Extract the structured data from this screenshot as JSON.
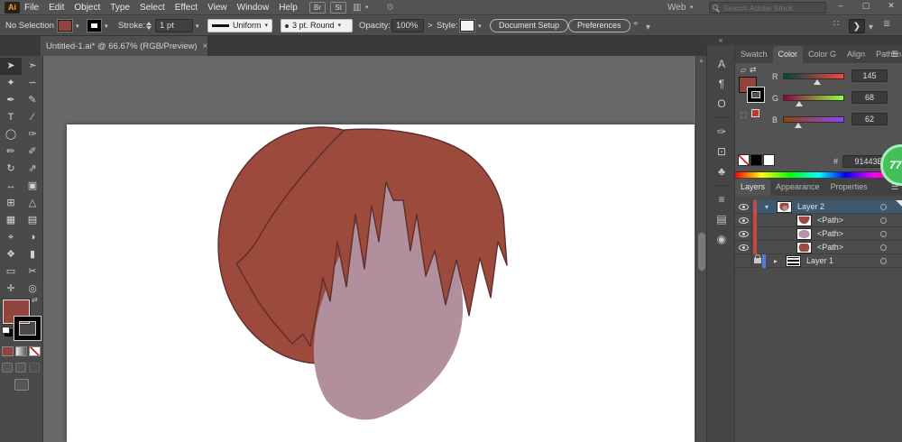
{
  "titlebar": {
    "logo": "Ai",
    "menus": [
      "File",
      "Edit",
      "Object",
      "Type",
      "Select",
      "Effect",
      "View",
      "Window",
      "Help"
    ],
    "bridge_button": "Br",
    "stock_button": "St",
    "workspace_label": "Web",
    "search_placeholder": "Search Adobe Stock",
    "minimize": "–",
    "maximize": "▢",
    "close": "✕"
  },
  "control_bar": {
    "selection_status": "No Selection",
    "stroke_label": "Stroke:",
    "stroke_width": "1 pt",
    "variable_width_profile": "Uniform",
    "brush_definition": "3 pt. Round",
    "opacity_label": "Opacity:",
    "opacity_value": "100%",
    "more_glyph": ">",
    "style_label": "Style:",
    "document_setup_label": "Document Setup",
    "preferences_label": "Preferences"
  },
  "document_tab": {
    "title": "Untitled-1.ai* @ 66.67% (RGB/Preview)",
    "close_glyph": "×"
  },
  "toolbar": {
    "tools": [
      {
        "name": "selection-tool",
        "glyph": "➤",
        "selected": true
      },
      {
        "name": "direct-selection-tool",
        "glyph": "➣"
      },
      {
        "name": "magic-wand-tool",
        "glyph": "✦"
      },
      {
        "name": "lasso-tool",
        "glyph": "∽"
      },
      {
        "name": "pen-tool",
        "glyph": "✒"
      },
      {
        "name": "curvature-tool",
        "glyph": "✎"
      },
      {
        "name": "type-tool",
        "glyph": "T"
      },
      {
        "name": "line-segment-tool",
        "glyph": "∕"
      },
      {
        "name": "ellipse-tool",
        "glyph": "◯"
      },
      {
        "name": "paintbrush-tool",
        "glyph": "✑"
      },
      {
        "name": "pencil-tool",
        "glyph": "✏"
      },
      {
        "name": "shaper-tool",
        "glyph": "✐"
      },
      {
        "name": "rotate-tool",
        "glyph": "↻"
      },
      {
        "name": "scale-tool",
        "glyph": "⇗"
      },
      {
        "name": "width-tool",
        "glyph": "↔"
      },
      {
        "name": "free-transform-tool",
        "glyph": "▣"
      },
      {
        "name": "shape-builder-tool",
        "glyph": "⊞"
      },
      {
        "name": "perspective-grid-tool",
        "glyph": "△"
      },
      {
        "name": "mesh-tool",
        "glyph": "▦"
      },
      {
        "name": "gradient-tool",
        "glyph": "▤"
      },
      {
        "name": "eyedropper-tool",
        "glyph": "⌖"
      },
      {
        "name": "blend-tool",
        "glyph": "◑"
      },
      {
        "name": "symbol-sprayer-tool",
        "glyph": "❖"
      },
      {
        "name": "column-graph-tool",
        "glyph": "▮"
      },
      {
        "name": "artboard-tool",
        "glyph": "▭"
      },
      {
        "name": "slice-tool",
        "glyph": "✂"
      },
      {
        "name": "hand-tool",
        "glyph": "✛"
      },
      {
        "name": "zoom-tool",
        "glyph": "◎"
      }
    ]
  },
  "dock": {
    "collapse_glyph": "«",
    "groups": [
      [
        {
          "name": "character-panel-icon",
          "glyph": "A"
        },
        {
          "name": "paragraph-panel-icon",
          "glyph": "¶"
        },
        {
          "name": "opentype-panel-icon",
          "glyph": "O"
        }
      ],
      [
        {
          "name": "brushes-panel-icon",
          "glyph": "✑"
        },
        {
          "name": "libraries-panel-icon",
          "glyph": "⊡"
        },
        {
          "name": "symbols-panel-icon",
          "glyph": "♣"
        }
      ],
      [
        {
          "name": "stroke-panel-icon",
          "glyph": "≡"
        },
        {
          "name": "gradient-panel-icon",
          "glyph": "▤"
        },
        {
          "name": "transparency-panel-icon",
          "glyph": "◉"
        }
      ]
    ]
  },
  "panels": {
    "tab_row": [
      "Swatch",
      "Color",
      "Color G",
      "Align",
      "Pathfin"
    ],
    "active_tab": "Color",
    "panel_menu_glyph": "☰",
    "color_panel": {
      "r_label": "R",
      "r_value": "145",
      "g_label": "G",
      "g_value": "68",
      "b_label": "B",
      "b_value": "62",
      "hex_label": "#",
      "hex_value": "91443E"
    },
    "layers_panel": {
      "tabs": [
        "Layers",
        "Appearance",
        "Properties"
      ],
      "active_tab": "Layers",
      "rows": [
        {
          "label": "Layer 2",
          "selected": true,
          "expanded": true,
          "eye": true,
          "color": "#cb4742",
          "thumb": "art-all"
        },
        {
          "label": "<Path>",
          "eye": true,
          "color": "#cb4742",
          "thumb": "art-fronthair",
          "indent": true
        },
        {
          "label": "<Path>",
          "eye": true,
          "color": "#cb4742",
          "thumb": "art-face",
          "indent": true
        },
        {
          "label": "<Path>",
          "eye": true,
          "color": "#cb4742",
          "thumb": "art-backhair",
          "indent": true
        },
        {
          "label": "Layer 1",
          "locked": true,
          "collapsed": true,
          "eye": false,
          "color": "#4c7fd6",
          "thumb": "art-reference"
        }
      ]
    }
  },
  "artwork": {
    "hair_fill": "#9C4A3C",
    "hair_stroke": "#5E2E2C",
    "face_fill": "#B18F9D"
  },
  "overlay_badge": {
    "text": "77",
    "color": "#43c05c"
  },
  "icons": {
    "dropdown_chevron": "▾",
    "expand_chevron": "▸",
    "swap": "⇄",
    "grid_dots": "∷",
    "panel_box": "❯",
    "list": "≣",
    "arrange_documents": "▥",
    "gpu_settings": "⚙",
    "options_target": "⌖",
    "scroll_up": "▲"
  }
}
